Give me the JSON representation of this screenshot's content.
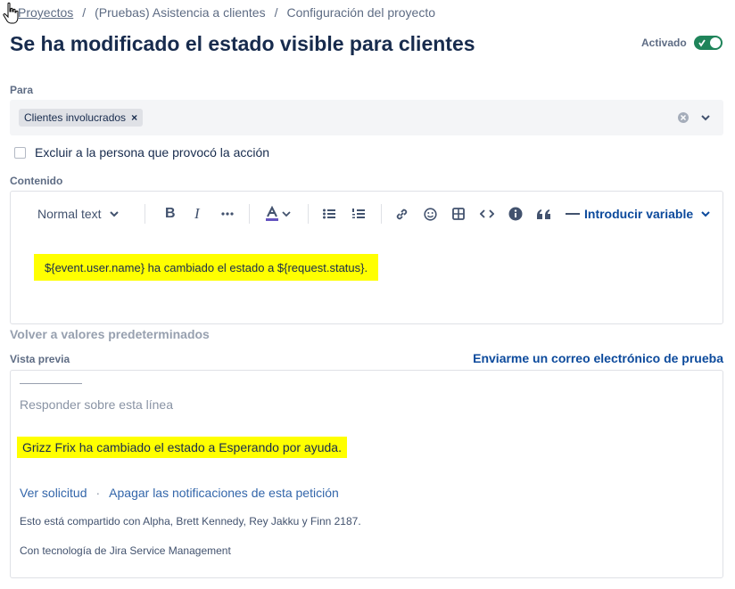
{
  "breadcrumb": {
    "items": [
      "Proyectos",
      "(Pruebas) Asistencia a clientes",
      "Configuración del proyecto"
    ],
    "separator": "/"
  },
  "page": {
    "title": "Se ha modificado el estado visible para clientes"
  },
  "toggle": {
    "label": "Activado",
    "on": true,
    "color": "#1f845a"
  },
  "recipients": {
    "label": "Para",
    "tags": [
      {
        "label": "Clientes involucrados",
        "remove": "×"
      }
    ]
  },
  "exclude": {
    "label": "Excluir a la persona que provocó la acción",
    "checked": false
  },
  "content": {
    "label": "Contenido",
    "toolbar": {
      "text_style": "Normal text",
      "insert_variable": "Introducir variable",
      "icons": [
        "bold-icon",
        "italic-icon",
        "more-icon",
        "text-color-icon",
        "bullet-list-icon",
        "numbered-list-icon",
        "link-icon",
        "emoji-icon",
        "table-icon",
        "code-icon",
        "info-icon",
        "quote-icon",
        "dash-icon"
      ]
    },
    "body": "${event.user.name} ha cambiado el estado a ${request.status}.",
    "highlight_color": "#ffff00"
  },
  "reset_link": "Volver a valores predeterminados",
  "preview": {
    "label": "Vista previa",
    "test_email_link": "Enviarme un correo electrónico de prueba",
    "reply_line": "Responder sobre esta línea",
    "message": "Grizz Frix ha cambiado el estado a Esperando por ayuda.",
    "links": [
      "Ver solicitud",
      "Apagar las notificaciones de esta petición"
    ],
    "link_separator": "·",
    "shared_with": "Esto está compartido con Alpha, Brett Kennedy, Rey Jakku y Finn 2187.",
    "powered_by": "Con tecnología de Jira Service Management"
  }
}
